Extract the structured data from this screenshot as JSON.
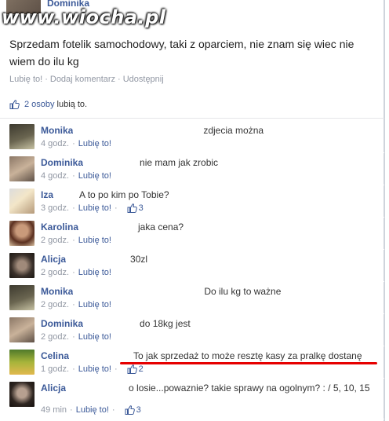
{
  "watermark": "www.wiocha.pl",
  "post": {
    "author": "Dominika",
    "text": "Sprzedam fotelik samochodowy, taki z oparciem, nie znam się wiec nie wiem do ilu kg",
    "actions": {
      "like": "Lubię to!",
      "comment": "Dodaj komentarz",
      "share": "Udostępnij",
      "separator": "·"
    },
    "likes_count": "2 osoby",
    "likes_suffix": "lubią to."
  },
  "comments": [
    {
      "name": "Monika",
      "text": "zdjecia można",
      "time": "4 godz.",
      "like": "Lubię to!",
      "likes": ""
    },
    {
      "name": "Dominika",
      "text": "nie mam jak zrobic",
      "time": "4 godz.",
      "like": "Lubię to!",
      "likes": ""
    },
    {
      "name": "Iza",
      "text": "A to po kim po Tobie?",
      "time": "3 godz.",
      "like": "Lubię to!",
      "likes": "3"
    },
    {
      "name": "Karolina",
      "text": "jaka cena?",
      "time": "2 godz.",
      "like": "Lubię to!",
      "likes": ""
    },
    {
      "name": "Alicja",
      "text": "30zl",
      "time": "2 godz.",
      "like": "Lubię to!",
      "likes": ""
    },
    {
      "name": "Monika",
      "text": "Do ilu kg to ważne",
      "time": "2 godz.",
      "like": "Lubię to!",
      "likes": ""
    },
    {
      "name": "Dominika",
      "text": "do 18kg jest",
      "time": "2 godz.",
      "like": "Lubię to!",
      "likes": ""
    },
    {
      "name": "Celina",
      "text": "To jak sprzedaż to może resztę kasy za pralkę dostanę",
      "time": "1 godz.",
      "like": "Lubię to!",
      "likes": "2"
    },
    {
      "name": "Alicja",
      "text": "o losie...powaznie? takie sprawy na ogolnym? : / 5, 10, 15",
      "time": "49 min",
      "like": "Lubię to!",
      "likes": "3"
    }
  ],
  "colors": {
    "link": "#3b5998",
    "meta": "#9197a3",
    "highlight_underline": "#e60000"
  }
}
